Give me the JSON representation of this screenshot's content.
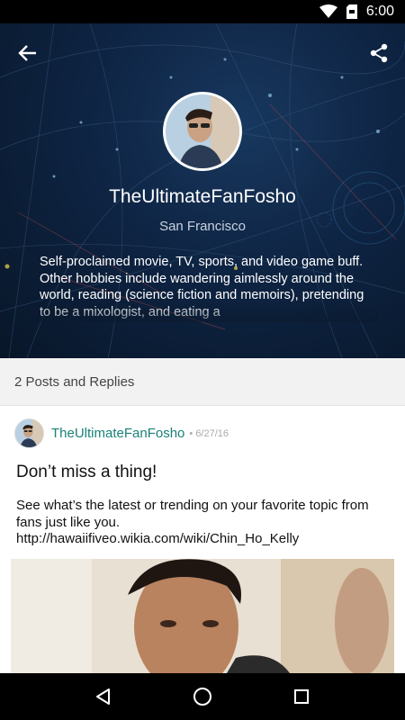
{
  "status_bar": {
    "time": "6:00",
    "icons": [
      "wifi-icon",
      "sd-card-icon",
      "battery-icon"
    ]
  },
  "profile": {
    "username": "TheUltimateFanFosho",
    "location": "San Francisco",
    "bio": "Self-proclaimed movie, TV, sports, and video game buff. Other hobbies include wandering aimlessly around the world, reading (science fiction and memoirs), pretending to be a mixologist, and eating a"
  },
  "toolbar": {
    "back_icon": "arrow-back-icon",
    "share_icon": "share-icon"
  },
  "posts_header": "2 Posts and Replies",
  "posts": [
    {
      "author": "TheUltimateFanFosho",
      "date": "• 6/27/16",
      "title": "Don’t miss a thing!",
      "body": "See what’s the latest or trending on your favorite topic from fans just like you. http://hawaiifiveo.wikia.com/wiki/Chin_Ho_Kelly"
    }
  ],
  "nav": {
    "icons": [
      "back-triangle-icon",
      "home-circle-icon",
      "recents-square-icon"
    ]
  },
  "colors": {
    "accent": "#1a8277",
    "hero_bg": "#0e2443"
  }
}
